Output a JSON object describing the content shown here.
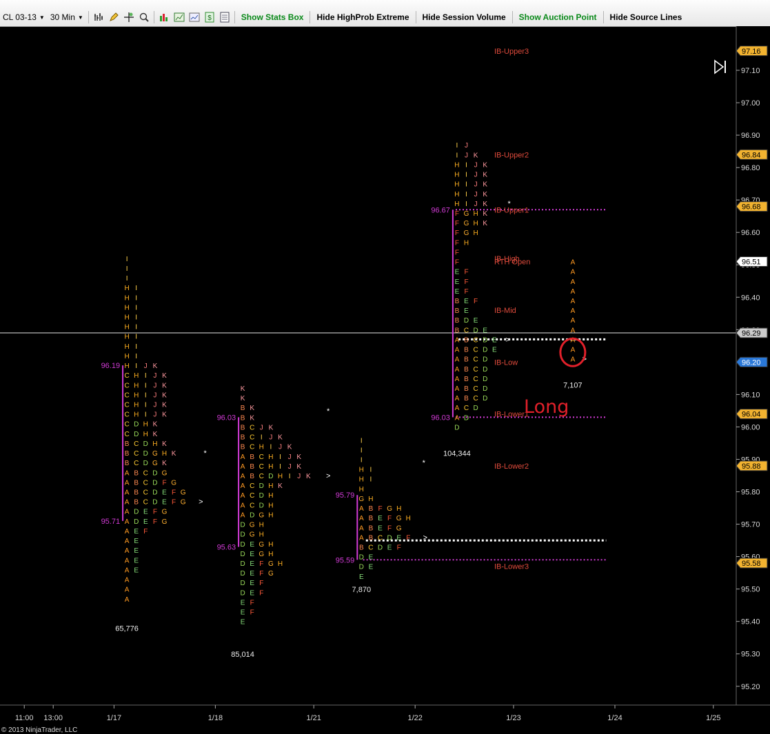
{
  "toolbar": {
    "instrument": "CL 03-13",
    "timeframe": "30 Min",
    "buttons": [
      {
        "label": "Show Stats Box",
        "color": "#0a8a1a",
        "name": "show-stats-box-button"
      },
      {
        "label": "Hide HighProb Extreme",
        "color": "#000000",
        "name": "hide-highprob-extreme-button"
      },
      {
        "label": "Hide Session Volume",
        "color": "#000000",
        "name": "hide-session-volume-button"
      },
      {
        "label": "Show Auction Point",
        "color": "#0a8a1a",
        "name": "show-auction-point-button"
      },
      {
        "label": "Hide Source Lines",
        "color": "#000000",
        "name": "hide-source-lines-button"
      }
    ],
    "icons": [
      "bar-style-icon",
      "pencil-draw-icon",
      "crosshair-icon",
      "zoom-icon",
      "chart-props-icon",
      "indicators-icon",
      "strategies-icon",
      "dollar-icon",
      "data-box-icon"
    ]
  },
  "copyright": "© 2013 NinjaTrader, LLC",
  "annotation": "Long",
  "chart_data": {
    "type": "market-profile",
    "instrument": "CL 03-13 (30 Min)",
    "y_range": [
      95.15,
      97.25
    ],
    "y_ticks": [
      97.1,
      97.0,
      96.9,
      96.8,
      96.7,
      96.6,
      96.5,
      96.4,
      96.3,
      96.1,
      96.0,
      95.9,
      95.8,
      95.7,
      95.6,
      95.5,
      95.4,
      95.3,
      95.2
    ],
    "x_labels": [
      {
        "label": "11:00",
        "slot": 0.6
      },
      {
        "label": "13:00",
        "slot": 1.6
      },
      {
        "label": "1/17",
        "slot": 3.7
      },
      {
        "label": "1/18",
        "slot": 7.2
      },
      {
        "label": "1/21",
        "slot": 10.6
      },
      {
        "label": "1/22",
        "slot": 14.1
      },
      {
        "label": "1/23",
        "slot": 17.5
      },
      {
        "label": "1/24",
        "slot": 21.0
      },
      {
        "label": "1/25",
        "slot": 24.4
      }
    ],
    "price_tags": [
      {
        "price": 97.16,
        "label": "97.16",
        "color": "#f2b330"
      },
      {
        "price": 96.84,
        "label": "96.84",
        "color": "#f2b330"
      },
      {
        "price": 96.68,
        "label": "96.68",
        "color": "#f2b330"
      },
      {
        "price": 96.51,
        "label": "96.51",
        "color": "#ffffff"
      },
      {
        "price": 96.29,
        "label": "96.29",
        "color": "#cccccc"
      },
      {
        "price": 96.2,
        "label": "96.20",
        "color": "#2a78d8"
      },
      {
        "price": 96.04,
        "label": "96.04",
        "color": "#f2b330"
      },
      {
        "price": 95.88,
        "label": "95.88",
        "color": "#f2b330"
      },
      {
        "price": 95.58,
        "label": "95.58",
        "color": "#f2b330"
      }
    ],
    "crosshair_price": 96.29,
    "ib_levels": [
      {
        "label": "IB-Upper3",
        "price": 97.16
      },
      {
        "label": "IB-Upper2",
        "price": 96.84
      },
      {
        "label": "IB-Upper1",
        "price": 96.67
      },
      {
        "label": "IB-High",
        "price": 96.52
      },
      {
        "label": "RTH Open",
        "price": 96.51
      },
      {
        "label": "IB-Mid",
        "price": 96.36
      },
      {
        "label": "IB-Low",
        "price": 96.2
      },
      {
        "label": "IB-Lower1",
        "price": 96.04
      },
      {
        "label": "IB-Lower2",
        "price": 95.88
      },
      {
        "label": "IB-Lower3",
        "price": 95.57
      }
    ],
    "ib_guides": [
      {
        "price": 96.67,
        "slot_from": 15.5,
        "slot_to": 20.7,
        "style": "magenta-dots"
      },
      {
        "price": 96.03,
        "slot_from": 15.5,
        "slot_to": 20.7,
        "style": "magenta-dots"
      },
      {
        "price": 95.59,
        "slot_from": 12.3,
        "slot_to": 20.7,
        "style": "magenta-dots"
      },
      {
        "price": 96.27,
        "slot_from": 15.6,
        "slot_to": 20.7,
        "style": "white-dashes"
      },
      {
        "price": 95.65,
        "slot_from": 12.4,
        "slot_to": 20.7,
        "style": "white-dashes"
      }
    ],
    "sessions": [
      {
        "volume": "65,776",
        "start_slot": 4.05,
        "low": 95.46,
        "ib_high": 96.19,
        "ib_low": 95.71,
        "ib_high_label": "96.19",
        "ib_low_label": "95.71",
        "rows": [
          {
            "price": 96.52,
            "letters": "I"
          },
          {
            "price": 96.49,
            "letters": "I"
          },
          {
            "price": 96.46,
            "letters": "I"
          },
          {
            "price": 96.43,
            "letters": "HI"
          },
          {
            "price": 96.4,
            "letters": "HI"
          },
          {
            "price": 96.37,
            "letters": "HI"
          },
          {
            "price": 96.34,
            "letters": "HI"
          },
          {
            "price": 96.31,
            "letters": "HI"
          },
          {
            "price": 96.28,
            "letters": "HI"
          },
          {
            "price": 96.25,
            "letters": "HI"
          },
          {
            "price": 96.22,
            "letters": "HI"
          },
          {
            "price": 96.19,
            "letters": "HIJK"
          },
          {
            "price": 96.16,
            "letters": "CHIJK"
          },
          {
            "price": 96.13,
            "letters": "CHIJK"
          },
          {
            "price": 96.1,
            "letters": "CHIJK"
          },
          {
            "price": 96.07,
            "letters": "CHIJK"
          },
          {
            "price": 96.04,
            "letters": "CHIJK"
          },
          {
            "price": 96.01,
            "letters": "CDHK"
          },
          {
            "price": 95.98,
            "letters": "CDHK"
          },
          {
            "price": 95.95,
            "letters": "BCDHK"
          },
          {
            "price": 95.92,
            "letters": "BCDGHK"
          },
          {
            "price": 95.89,
            "letters": "BCDGK"
          },
          {
            "price": 95.86,
            "letters": "ABCDG"
          },
          {
            "price": 95.83,
            "letters": "ABCDFG"
          },
          {
            "price": 95.8,
            "letters": "ABCDEFG"
          },
          {
            "price": 95.77,
            "letters": "ABCDEFG"
          },
          {
            "price": 95.74,
            "letters": "ADEFG"
          },
          {
            "price": 95.71,
            "letters": "ADEFG"
          },
          {
            "price": 95.68,
            "letters": "AEF"
          },
          {
            "price": 95.65,
            "letters": "AE"
          },
          {
            "price": 95.62,
            "letters": "AE"
          },
          {
            "price": 95.59,
            "letters": "AE"
          },
          {
            "price": 95.56,
            "letters": "AE"
          },
          {
            "price": 95.53,
            "letters": "A"
          },
          {
            "price": 95.5,
            "letters": "A"
          },
          {
            "price": 95.47,
            "letters": "A"
          }
        ],
        "markers": [
          {
            "price": 95.77,
            "slot": 6.7,
            "text": ">"
          },
          {
            "price": 95.92,
            "slot": 6.85,
            "text": "*"
          }
        ]
      },
      {
        "volume": "85,014",
        "start_slot": 8.05,
        "low": 95.38,
        "ib_high": 96.03,
        "ib_low": 95.63,
        "ib_high_label": "96.03",
        "ib_low_label": "95.63",
        "rows": [
          {
            "price": 96.12,
            "letters": "K"
          },
          {
            "price": 96.09,
            "letters": "K"
          },
          {
            "price": 96.06,
            "letters": "BK"
          },
          {
            "price": 96.03,
            "letters": "BK"
          },
          {
            "price": 96.0,
            "letters": "BCJK"
          },
          {
            "price": 95.97,
            "letters": "BCIJK"
          },
          {
            "price": 95.94,
            "letters": "BCHIJK"
          },
          {
            "price": 95.91,
            "letters": "ABCHIJK"
          },
          {
            "price": 95.88,
            "letters": "ABCHIJK"
          },
          {
            "price": 95.85,
            "letters": "ABCDHIJK"
          },
          {
            "price": 95.82,
            "letters": "ACDHK"
          },
          {
            "price": 95.79,
            "letters": "ACDH"
          },
          {
            "price": 95.76,
            "letters": "ACDH"
          },
          {
            "price": 95.73,
            "letters": "ADGH"
          },
          {
            "price": 95.7,
            "letters": "DGH"
          },
          {
            "price": 95.67,
            "letters": "DGH"
          },
          {
            "price": 95.64,
            "letters": "DEGH"
          },
          {
            "price": 95.61,
            "letters": "DEGH"
          },
          {
            "price": 95.58,
            "letters": "DEFGH"
          },
          {
            "price": 95.55,
            "letters": "DEFG"
          },
          {
            "price": 95.52,
            "letters": "DEF"
          },
          {
            "price": 95.49,
            "letters": "DEF"
          },
          {
            "price": 95.46,
            "letters": "EF"
          },
          {
            "price": 95.43,
            "letters": "EF"
          },
          {
            "price": 95.4,
            "letters": "E"
          }
        ],
        "markers": [
          {
            "price": 95.85,
            "slot": 11.1,
            "text": ">"
          },
          {
            "price": 96.05,
            "slot": 11.1,
            "text": "*"
          }
        ]
      },
      {
        "volume": "7,870",
        "start_slot": 12.15,
        "low": 95.58,
        "ib_high": 95.79,
        "ib_low": 95.59,
        "ib_high_label": "95.79",
        "ib_low_label": "95.59",
        "rows": [
          {
            "price": 95.96,
            "letters": "I"
          },
          {
            "price": 95.93,
            "letters": "I"
          },
          {
            "price": 95.9,
            "letters": "I"
          },
          {
            "price": 95.87,
            "letters": "HI"
          },
          {
            "price": 95.84,
            "letters": "HI"
          },
          {
            "price": 95.81,
            "letters": "H"
          },
          {
            "price": 95.78,
            "letters": "GH"
          },
          {
            "price": 95.75,
            "letters": "ABFGH"
          },
          {
            "price": 95.72,
            "letters": "ABEFGH"
          },
          {
            "price": 95.69,
            "letters": "ABEFG"
          },
          {
            "price": 95.66,
            "letters": "ABCDEF"
          },
          {
            "price": 95.63,
            "letters": "BCDEF"
          },
          {
            "price": 95.6,
            "letters": "DE"
          },
          {
            "price": 95.57,
            "letters": "DE"
          },
          {
            "price": 95.54,
            "letters": "E"
          }
        ],
        "markers": [
          {
            "price": 95.66,
            "slot": 14.45,
            "text": ">"
          },
          {
            "price": 95.89,
            "slot": 14.4,
            "text": "*"
          }
        ]
      },
      {
        "volume": "104,344",
        "start_slot": 15.45,
        "low": 96.0,
        "ib_high": 96.67,
        "ib_low": 96.03,
        "ib_high_label": "96.67",
        "ib_low_label": "96.03",
        "rows": [
          {
            "price": 96.87,
            "letters": "IJ"
          },
          {
            "price": 96.84,
            "letters": "IJK"
          },
          {
            "price": 96.81,
            "letters": "HIJK"
          },
          {
            "price": 96.78,
            "letters": "HIJK"
          },
          {
            "price": 96.75,
            "letters": "HIJK"
          },
          {
            "price": 96.72,
            "letters": "HIJK"
          },
          {
            "price": 96.69,
            "letters": "HIJK"
          },
          {
            "price": 96.66,
            "letters": "FGHK"
          },
          {
            "price": 96.63,
            "letters": "FGHK"
          },
          {
            "price": 96.6,
            "letters": "FGH"
          },
          {
            "price": 96.57,
            "letters": "FH"
          },
          {
            "price": 96.54,
            "letters": "F"
          },
          {
            "price": 96.51,
            "letters": "F"
          },
          {
            "price": 96.48,
            "letters": "EF"
          },
          {
            "price": 96.45,
            "letters": "EF"
          },
          {
            "price": 96.42,
            "letters": "EF"
          },
          {
            "price": 96.39,
            "letters": "BEF"
          },
          {
            "price": 96.36,
            "letters": "BE"
          },
          {
            "price": 96.33,
            "letters": "BDE"
          },
          {
            "price": 96.3,
            "letters": "BCDE"
          },
          {
            "price": 96.27,
            "letters": "ABCDE"
          },
          {
            "price": 96.24,
            "letters": "ABCDE"
          },
          {
            "price": 96.21,
            "letters": "ABCD"
          },
          {
            "price": 96.18,
            "letters": "ABCD"
          },
          {
            "price": 96.15,
            "letters": "ABCD"
          },
          {
            "price": 96.12,
            "letters": "ABCD"
          },
          {
            "price": 96.09,
            "letters": "ABCD"
          },
          {
            "price": 96.06,
            "letters": "ACD"
          },
          {
            "price": 96.03,
            "letters": "AD"
          },
          {
            "price": 96.0,
            "letters": "D"
          }
        ],
        "markers": [
          {
            "price": 96.27,
            "slot": 17.3,
            "text": ">"
          },
          {
            "price": 96.69,
            "slot": 17.35,
            "text": "*"
          }
        ]
      },
      {
        "volume": "7,107",
        "start_slot": 19.45,
        "low": 96.21,
        "ib_high": null,
        "ib_low": null,
        "rows": [
          {
            "price": 96.51,
            "letters": "A"
          },
          {
            "price": 96.48,
            "letters": "A"
          },
          {
            "price": 96.45,
            "letters": "A"
          },
          {
            "price": 96.42,
            "letters": "A"
          },
          {
            "price": 96.39,
            "letters": "A"
          },
          {
            "price": 96.36,
            "letters": "A"
          },
          {
            "price": 96.33,
            "letters": "A"
          },
          {
            "price": 96.3,
            "letters": "A"
          },
          {
            "price": 96.27,
            "letters": "A"
          },
          {
            "price": 96.24,
            "letters": "A"
          },
          {
            "price": 96.21,
            "letters": "A"
          }
        ],
        "markers": [
          {
            "price": 96.21,
            "slot": 19.95,
            "text": ">"
          }
        ]
      }
    ],
    "letter_colors": {
      "A": "#ff9a22",
      "B": "#ff8a50",
      "C": "#ffcc33",
      "D": "#9bdc5a",
      "E": "#88e07a",
      "F": "#ff5a3a",
      "G": "#ffb030",
      "H": "#ffb020",
      "I": "#ffd04a",
      "J": "#ff8080",
      "K": "#ff9aa0"
    },
    "highlight": {
      "price": 96.23,
      "slot": 19.45,
      "shape": "ellipse",
      "color": "#e0202a"
    }
  }
}
